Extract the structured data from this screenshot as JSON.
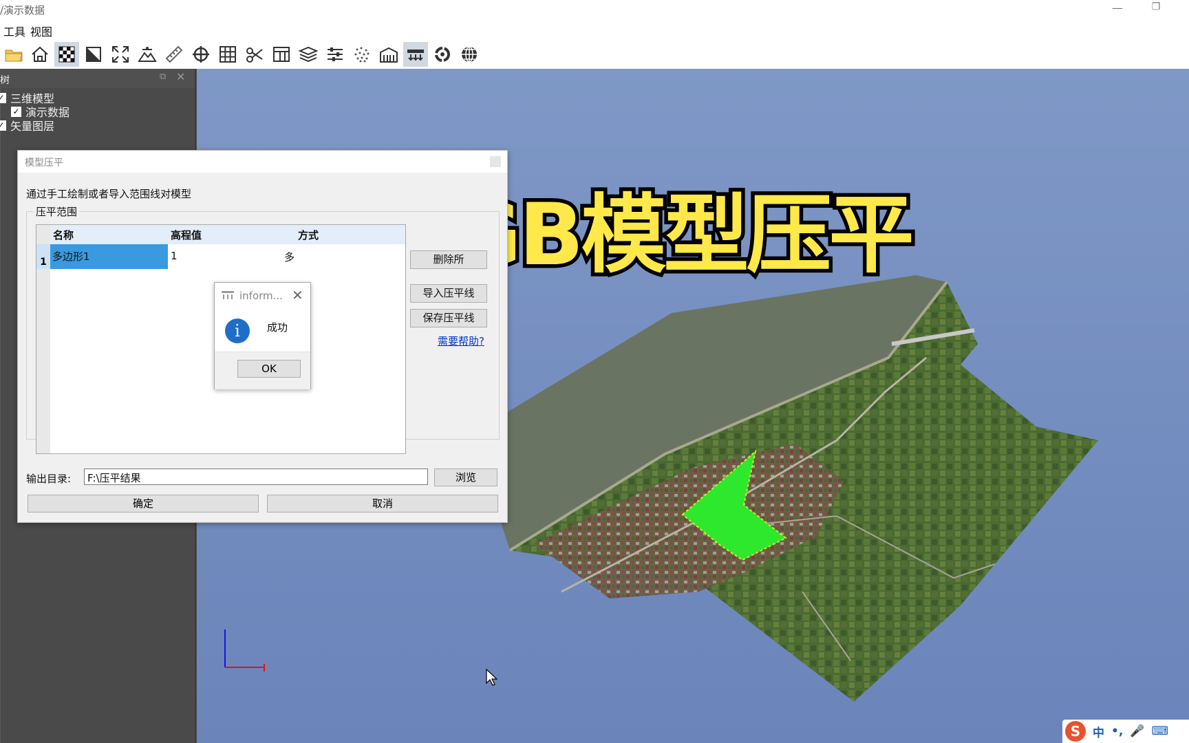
{
  "window": {
    "title": "/演示数据",
    "minimize": "—",
    "restore": "❐"
  },
  "menu": {
    "items": [
      "工具",
      "视图"
    ]
  },
  "toolbar": {
    "icons": [
      "folder-open-icon",
      "home-icon",
      "checkerboard-icon",
      "contrast-icon",
      "fullscreen-icon",
      "terrain-icon",
      "ruler-icon",
      "crosshair-icon",
      "grid-icon",
      "scissors-icon",
      "table-icon",
      "layers-icon",
      "sliders-icon",
      "noise-icon",
      "building-icon",
      "flatten-icon",
      "recycle-icon",
      "globe-icon"
    ]
  },
  "tree": {
    "title": "树",
    "float_icon": "⧉",
    "close_icon": "✕",
    "items": [
      {
        "label": "三维模型",
        "checked": true
      },
      {
        "label": "演示数据",
        "checked": true
      },
      {
        "label": "矢量图层",
        "checked": true
      }
    ]
  },
  "overlay": {
    "title": "对OSGB模型压平"
  },
  "dialog": {
    "title": "模型压平",
    "description": "通过手工绘制或者导入范围线对模型",
    "group_label": "压平范围",
    "columns": [
      "名称",
      "高程值",
      "方式"
    ],
    "rows": [
      {
        "num": "1",
        "name": "多边形1",
        "height": "1",
        "mode": "多"
      }
    ],
    "buttons": {
      "delete": "删除所",
      "import": "导入压平线",
      "save": "保存压平线"
    },
    "help": "需要帮助?",
    "output_label": "输出目录:",
    "output_value": "F:\\压平结果",
    "browse": "浏览",
    "ok": "确定",
    "cancel": "取消"
  },
  "message": {
    "title": "inform...",
    "close": "✕",
    "info": "i",
    "text": "成功",
    "ok": "OK"
  },
  "ime": {
    "logo": "S",
    "items": [
      "中",
      "•,",
      "🎤",
      "⌨"
    ]
  },
  "colors": {
    "accent_yellow": "#ffe94a",
    "flatten_green": "#2ee82e",
    "viewport_blue": "#7b93c3",
    "selection_blue": "#3a9ae0"
  }
}
